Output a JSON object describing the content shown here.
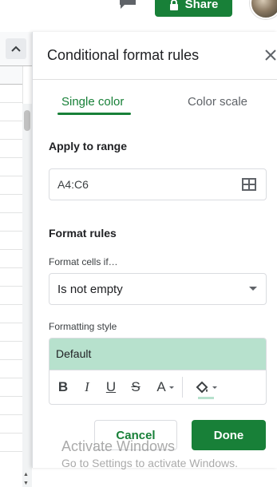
{
  "header": {
    "share_label": "Share"
  },
  "panel": {
    "title": "Conditional format rules",
    "tabs": [
      {
        "label": "Single color",
        "selected": true
      },
      {
        "label": "Color scale",
        "selected": false
      }
    ],
    "apply_to_range": {
      "label": "Apply to range",
      "value": "A4:C6"
    },
    "format_rules": {
      "label": "Format rules",
      "condition_label": "Format cells if…",
      "condition_value": "Is not empty"
    },
    "formatting_style": {
      "label": "Formatting style",
      "preview_text": "Default",
      "preview_color": "#b7e1cd",
      "toolbar": {
        "bold": "B",
        "italic": "I",
        "underline": "U",
        "strikethrough": "S",
        "text_color": "A"
      }
    },
    "cancel_label": "Cancel",
    "done_label": "Done"
  },
  "watermark": {
    "line1": "Activate Windows",
    "line2": "Go to Settings to activate Windows."
  },
  "colors": {
    "accent": "#188038",
    "preview_fill": "#b7e1cd"
  }
}
